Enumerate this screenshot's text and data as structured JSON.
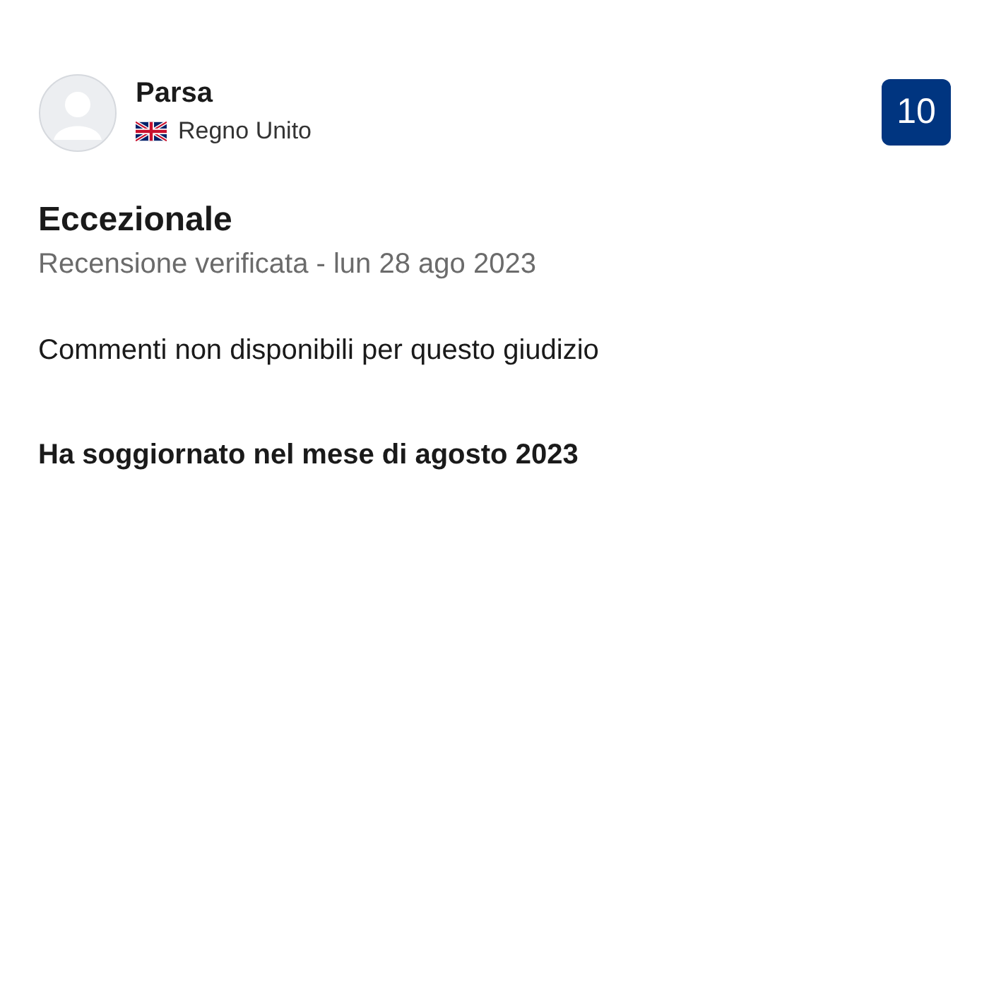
{
  "reviewer": {
    "name": "Parsa",
    "country": "Regno Unito"
  },
  "score": "10",
  "review": {
    "title": "Eccezionale",
    "meta": "Recensione verificata - lun 28 ago 2023",
    "comment": "Commenti non disponibili per questo giudizio",
    "stay": "Ha soggiornato nel mese di agosto 2023"
  }
}
